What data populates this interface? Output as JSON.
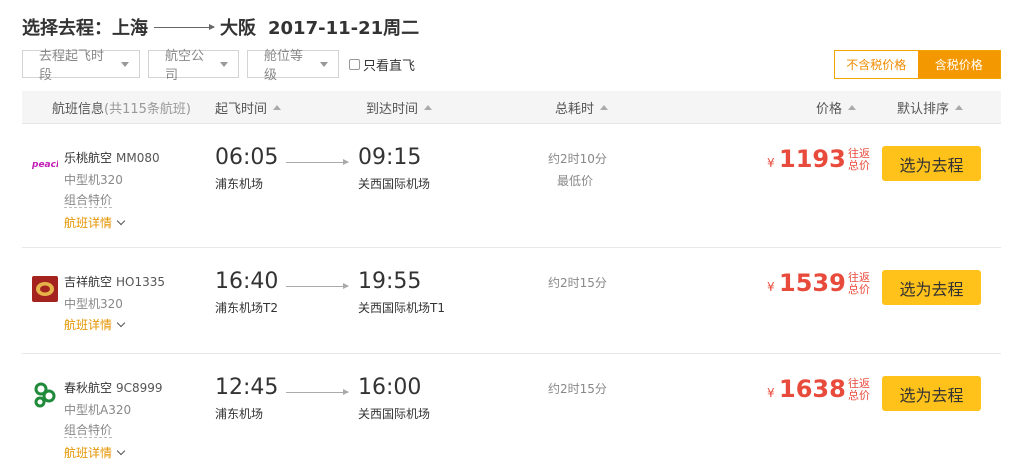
{
  "page": {
    "title_prefix": "选择去程：",
    "from_city": "上海",
    "to_city": "大阪",
    "date": "2017-11-21周二"
  },
  "filters": {
    "dropdowns": [
      "去程起飞时段",
      "航空公司",
      "舱位等级"
    ],
    "direct_only_label": "只看直飞"
  },
  "tax_toggle": {
    "exclude_label": "不含税价格",
    "include_label": "含税价格",
    "selected": "含税价格"
  },
  "table_header": {
    "flight_info": "航班信息",
    "flight_count": "(共115条航班)",
    "depart": "起飞时间",
    "arrive": "到达时间",
    "duration": "总耗时",
    "price": "价格",
    "default_sort": "默认排序"
  },
  "flights": [
    {
      "airline": "乐桃航空",
      "flight_no": "MM080",
      "aircraft": "中型机320",
      "special": "组合特价",
      "detail_label": "航班详情",
      "dep_time": "06:05",
      "dep_airport": "浦东机场",
      "arr_time": "09:15",
      "arr_airport": "关西国际机场",
      "duration": "约2时10分",
      "lowest_tag": "最低价",
      "currency": "¥",
      "price": "1193",
      "price_note": "往返总价",
      "select_label": "选为去程",
      "logo_icon": "peach-logo-icon",
      "logo_color": "#c21db5"
    },
    {
      "airline": "吉祥航空",
      "flight_no": "HO1335",
      "aircraft": "中型机320",
      "special": "",
      "detail_label": "航班详情",
      "dep_time": "16:40",
      "dep_airport": "浦东机场T2",
      "arr_time": "19:55",
      "arr_airport": "关西国际机场T1",
      "duration": "约2时15分",
      "lowest_tag": "",
      "currency": "¥",
      "price": "1539",
      "price_note": "往返总价",
      "select_label": "选为去程",
      "logo_icon": "juneyao-logo-icon",
      "logo_color": "#a5231f"
    },
    {
      "airline": "春秋航空",
      "flight_no": "9C8999",
      "aircraft": "中型机A320",
      "special": "组合特价",
      "detail_label": "航班详情",
      "dep_time": "12:45",
      "dep_airport": "浦东机场",
      "arr_time": "16:00",
      "arr_airport": "关西国际机场",
      "duration": "约2时15分",
      "lowest_tag": "",
      "currency": "¥",
      "price": "1638",
      "price_note": "往返总价",
      "select_label": "选为去程",
      "logo_icon": "spring-airlines-logo-icon",
      "logo_color": "#1f8a3a"
    }
  ],
  "colors": {
    "accent": "#f39800",
    "price": "#e84b3c",
    "button": "#ffc21a"
  }
}
